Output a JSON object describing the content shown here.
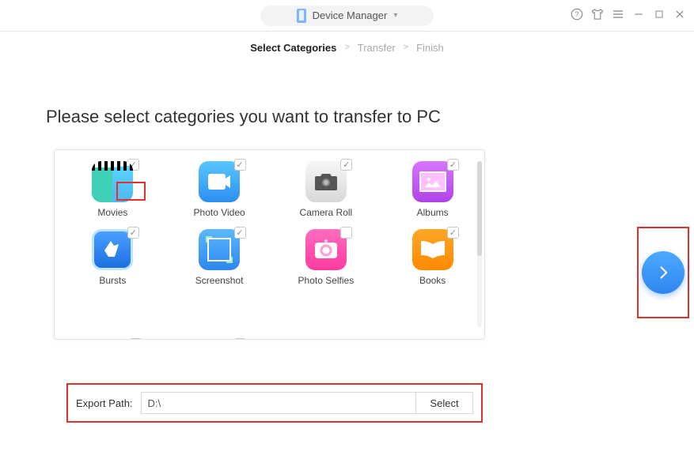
{
  "topbar": {
    "device_label": "Device Manager"
  },
  "breadcrumb": {
    "step1": "Select Categories",
    "step2": "Transfer",
    "step3": "Finish"
  },
  "headline": "Please select categories you want to transfer to PC",
  "categories": [
    {
      "label": "Movies",
      "checked": true
    },
    {
      "label": "Photo Video",
      "checked": true
    },
    {
      "label": "Camera Roll",
      "checked": true
    },
    {
      "label": "Albums",
      "checked": true
    },
    {
      "label": "Bursts",
      "checked": true
    },
    {
      "label": "Screenshot",
      "checked": true
    },
    {
      "label": "Photo Selfies",
      "checked": false
    },
    {
      "label": "Books",
      "checked": true
    }
  ],
  "export": {
    "label": "Export Path:",
    "value": "D:\\",
    "button": "Select"
  }
}
